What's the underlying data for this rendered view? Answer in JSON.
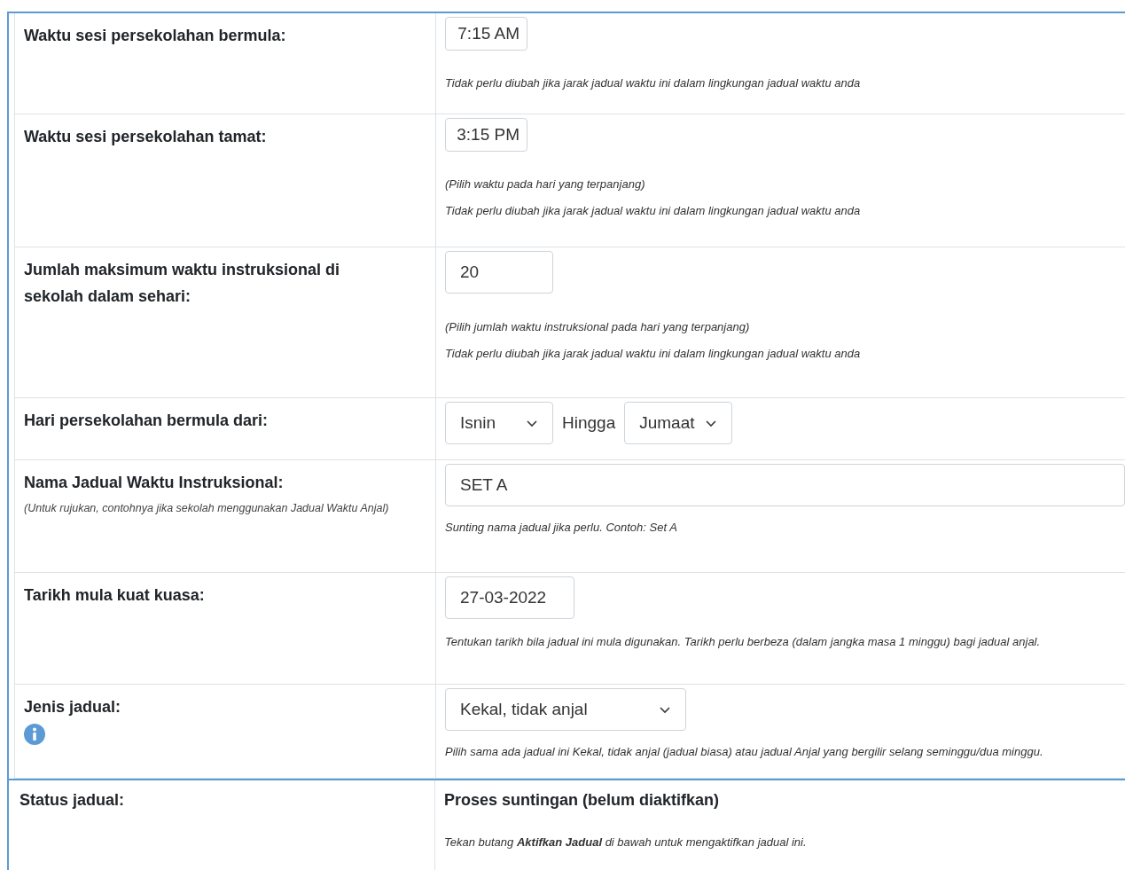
{
  "settings": [
    {
      "label": "Waktu sesi persekolahan bermula:",
      "controls": [
        {
          "kind": "time",
          "value": "7:15 AM"
        }
      ],
      "hints": [
        "Tidak perlu diubah jika jarak jadual waktu ini dalam lingkungan jadual waktu anda"
      ]
    },
    {
      "label": "Waktu sesi persekolahan tamat:",
      "controls": [
        {
          "kind": "time",
          "value": "3:15 PM"
        }
      ],
      "hints": [
        "(Pilih waktu pada hari yang terpanjang)",
        "Tidak perlu diubah jika jarak jadual waktu ini dalam lingkungan jadual waktu anda"
      ]
    },
    {
      "label": "Jumlah maksimum waktu instruksional di sekolah dalam sehari:",
      "controls": [
        {
          "kind": "number",
          "value": "20"
        }
      ],
      "hints": [
        "(Pilih jumlah waktu instruksional pada hari yang terpanjang)",
        "Tidak perlu diubah jika jarak jadual waktu ini dalam lingkungan jadual waktu anda"
      ]
    },
    {
      "label": "Hari persekolahan bermula dari:",
      "controls": [
        {
          "kind": "day-select",
          "value": "Isnin"
        },
        {
          "kind": "word",
          "value": "Hingga"
        },
        {
          "kind": "day-select",
          "value": "Jumaat"
        }
      ]
    },
    {
      "label": "Nama Jadual Waktu Instruksional:",
      "note": "(Untuk rujukan, contohnya jika sekolah menggunakan Jadual Waktu Anjal)",
      "controls": [
        {
          "kind": "text",
          "value": "SET A"
        }
      ],
      "hints": [
        "Sunting nama jadual jika perlu. Contoh: Set A"
      ]
    },
    {
      "label": "Tarikh mula kuat kuasa:",
      "controls": [
        {
          "kind": "date",
          "value": "27-03-2022"
        }
      ],
      "hints": [
        "Tentukan tarikh bila jadual ini mula digunakan. Tarikh perlu berbeza (dalam jangka masa 1 minggu) bagi jadual anjal."
      ]
    },
    {
      "label": "Jenis jadual:",
      "info": true,
      "controls": [
        {
          "kind": "type-select",
          "value": "Kekal, tidak anjal"
        }
      ],
      "hints": [
        "Pilih sama ada jadual ini Kekal, tidak anjal (jadual biasa) atau jadual Anjal yang bergilir selang seminggu/dua minggu."
      ]
    }
  ],
  "status": {
    "label": "Status jadual:",
    "value": "Proses suntingan (belum diaktifkan)",
    "hint": "Tekan butang **Aktifkan Jadual** di bawah untuk mengaktifkan jadual ini."
  }
}
